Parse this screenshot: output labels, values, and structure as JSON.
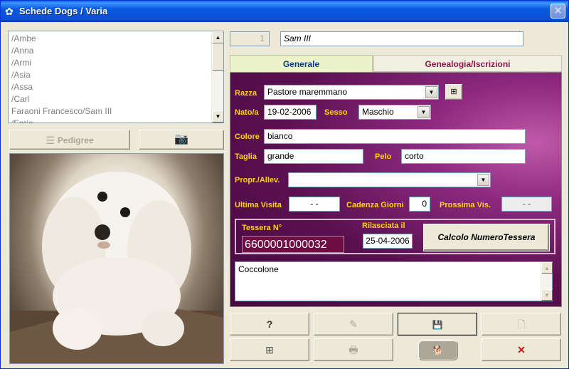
{
  "window": {
    "title": "Schede Dogs / Varia",
    "close_label": "✕"
  },
  "list": {
    "items": [
      "/Ambe",
      "/Anna",
      "/Armi",
      "/Asia",
      "/Assa",
      "/Carl",
      "Faraoni Francesco/Sam III",
      "/Fario"
    ]
  },
  "left_buttons": {
    "pedigree_label": "Pedigree"
  },
  "record": {
    "id": "1",
    "name": "Sam III"
  },
  "tabs": {
    "general": "Generale",
    "genealogy": "Genealogia/Iscrizioni"
  },
  "form": {
    "razza_label": "Razza",
    "razza_value": "Pastore maremmano",
    "nato_label": "Nato/a",
    "nato_value": "19-02-2006",
    "sesso_label": "Sesso",
    "sesso_value": "Maschio",
    "colore_label": "Colore",
    "colore_value": "bianco",
    "taglia_label": "Taglia",
    "taglia_value": "grande",
    "pelo_label": "Pelo",
    "pelo_value": "corto",
    "propr_label": "Propr./Allev.",
    "propr_value": "",
    "ultima_label": "Ultima Visita",
    "ultima_value": "- -",
    "cadenza_label": "Cadenza Giorni",
    "cadenza_value": "0",
    "prossima_label": "Prossima Vis.",
    "prossima_value": "- -",
    "tessera_label": "Tessera N°",
    "tessera_value": "6600001000032",
    "rilasciata_label": "Rilasciata il",
    "rilasciata_value": "25-04-2006",
    "calc_button": "Calcolo NumeroTessera",
    "notes": "Coccolone"
  },
  "toolbar": {
    "help": "?",
    "edit": "✎",
    "save": "💾",
    "delete_file": "🗋",
    "add": "⊞",
    "print": "🖶",
    "dog": "🐕",
    "cancel": "✕"
  },
  "colors": {
    "label_yellow": "#FFD400",
    "panel_purple": "#5A1050",
    "tab_blue_text": "#0B3C84",
    "tab_maroon_text": "#8B1A4A"
  }
}
